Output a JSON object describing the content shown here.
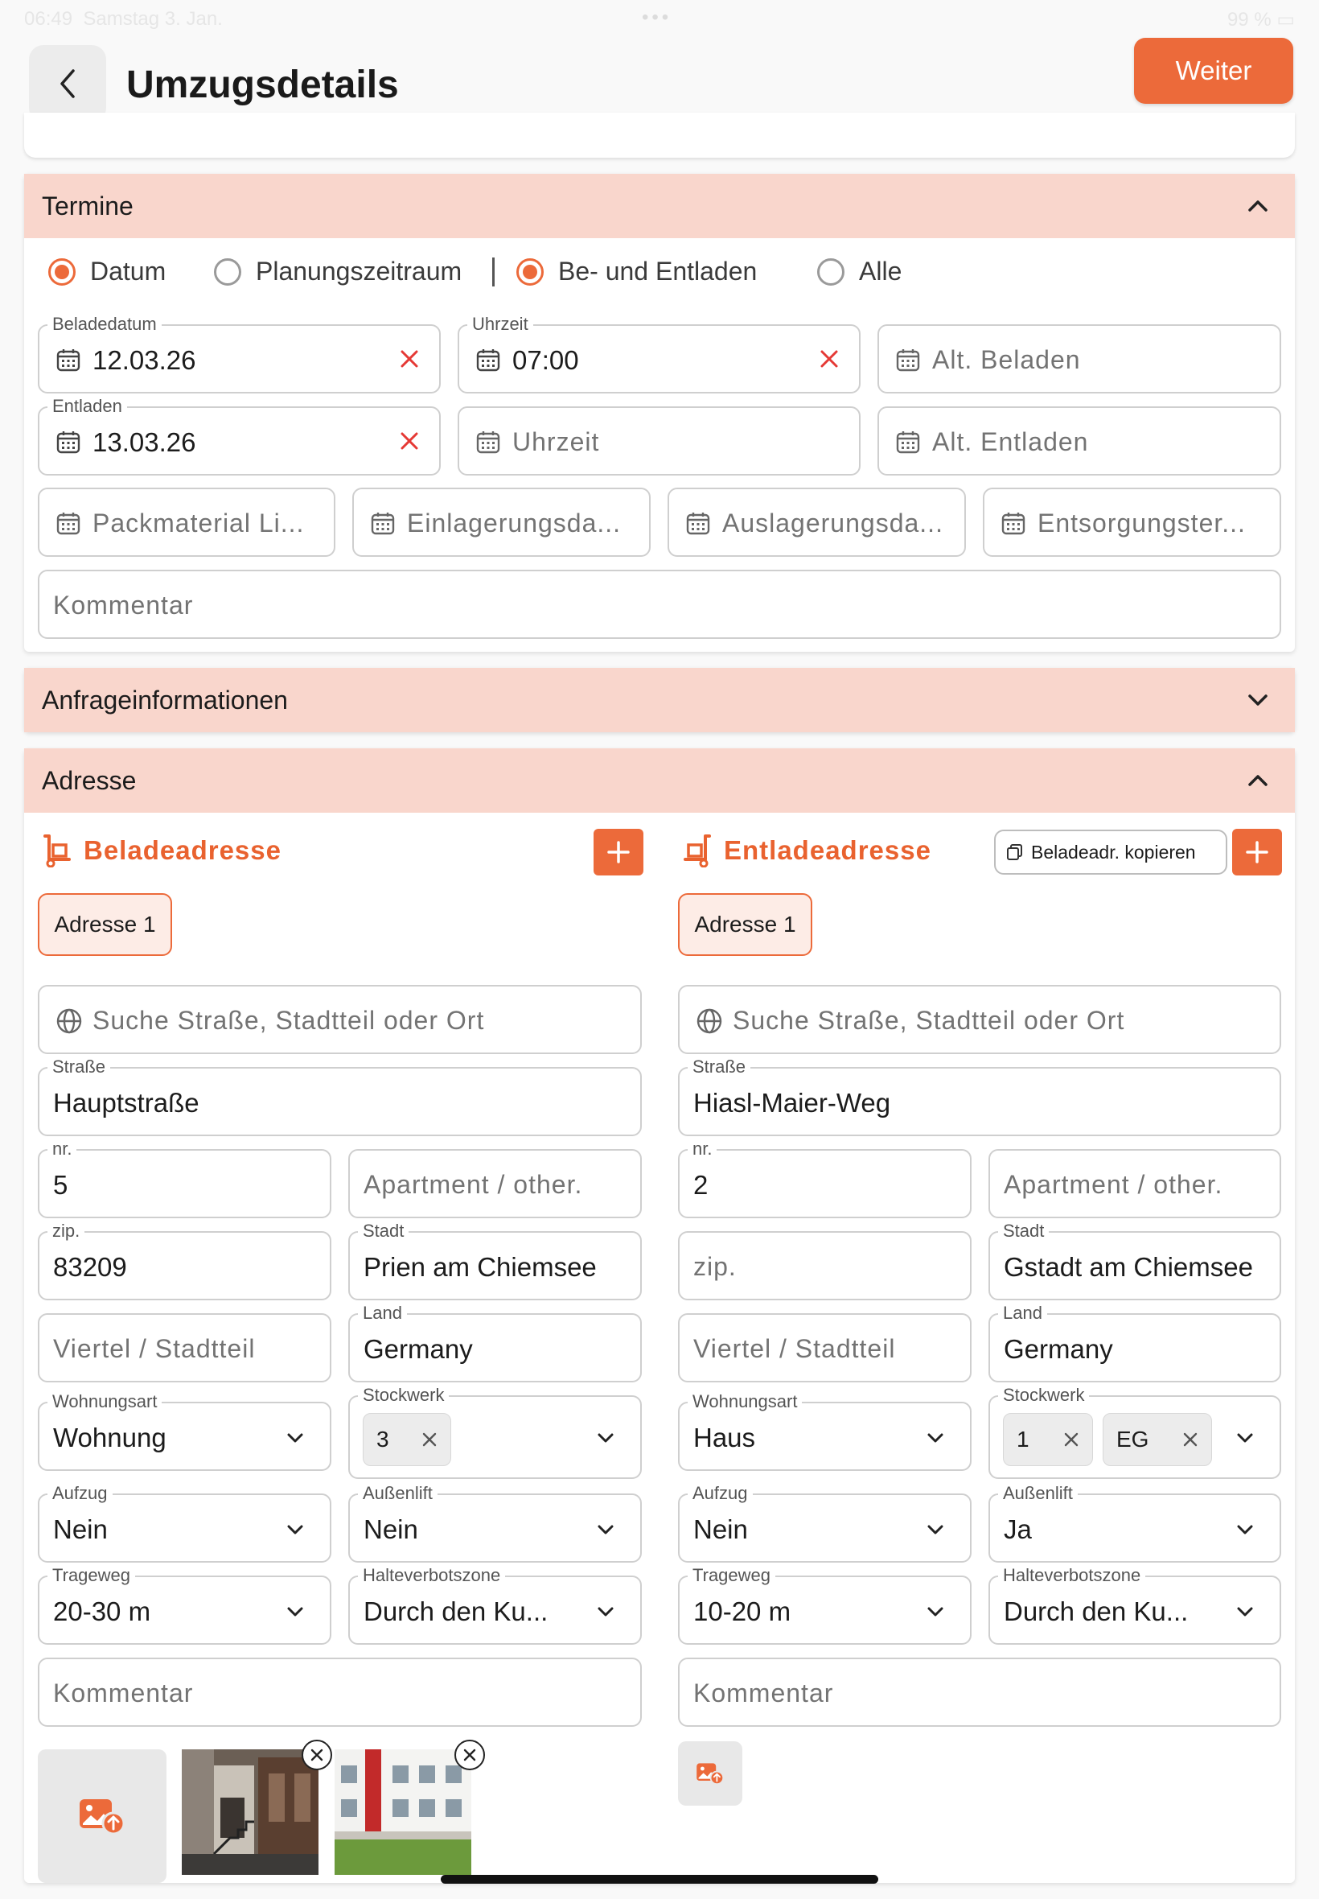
{
  "status": {
    "time": "06:49",
    "date": "Samstag 3. Jan.",
    "battery": "99 %"
  },
  "header": {
    "title": "Umzugsdetails",
    "next_label": "Weiter"
  },
  "termine": {
    "title": "Termine",
    "radios": {
      "datum": "Datum",
      "planung": "Planungszeitraum",
      "beentladen": "Be- und Entladen",
      "alle": "Alle"
    },
    "beladedatum": {
      "label": "Beladedatum",
      "value": "12.03.26"
    },
    "uhrzeit_belade": {
      "label": "Uhrzeit",
      "value": "07:00"
    },
    "alt_beladen": {
      "placeholder": "Alt. Beladen"
    },
    "entladen": {
      "label": "Entladen",
      "value": "13.03.26"
    },
    "uhrzeit_entlade": {
      "placeholder": "Uhrzeit"
    },
    "alt_entladen": {
      "placeholder": "Alt. Entladen"
    },
    "packmaterial": {
      "placeholder": "Packmaterial Li..."
    },
    "einlagerung": {
      "placeholder": "Einlagerungsda..."
    },
    "auslagerung": {
      "placeholder": "Auslagerungsda..."
    },
    "entsorgung": {
      "placeholder": "Entsorgungster..."
    },
    "kommentar": {
      "placeholder": "Kommentar"
    }
  },
  "anfrage": {
    "title": "Anfrageinformationen"
  },
  "adresse": {
    "title": "Adresse",
    "belade": {
      "title": "Beladeadresse",
      "tab": "Adresse 1",
      "search_placeholder": "Suche Straße, Stadtteil oder Ort",
      "strasse": {
        "label": "Straße",
        "value": "Hauptstraße"
      },
      "nr": {
        "label": "nr.",
        "value": "5"
      },
      "apartment": {
        "placeholder": "Apartment / other."
      },
      "zip": {
        "label": "zip.",
        "value": "83209"
      },
      "stadt": {
        "label": "Stadt",
        "value": "Prien am Chiemsee"
      },
      "viertel": {
        "placeholder": "Viertel / Stadtteil"
      },
      "land": {
        "label": "Land",
        "value": "Germany"
      },
      "wohnungsart": {
        "label": "Wohnungsart",
        "value": "Wohnung"
      },
      "stockwerk": {
        "label": "Stockwerk",
        "chips": [
          "3"
        ]
      },
      "aufzug": {
        "label": "Aufzug",
        "value": "Nein"
      },
      "aussenlift": {
        "label": "Außenlift",
        "value": "Nein"
      },
      "trageweg": {
        "label": "Trageweg",
        "value": "20-30 m"
      },
      "halteverbot": {
        "label": "Halteverbotszone",
        "value": "Durch den Ku..."
      },
      "kommentar": {
        "placeholder": "Kommentar"
      }
    },
    "entlade": {
      "title": "Entladeadresse",
      "copy_label": "Beladeadr. kopieren",
      "tab": "Adresse 1",
      "search_placeholder": "Suche Straße, Stadtteil oder Ort",
      "strasse": {
        "label": "Straße",
        "value": "Hiasl-Maier-Weg"
      },
      "nr": {
        "label": "nr.",
        "value": "2"
      },
      "apartment": {
        "placeholder": "Apartment / other."
      },
      "zip": {
        "placeholder": "zip."
      },
      "stadt": {
        "label": "Stadt",
        "value": "Gstadt am Chiemsee"
      },
      "viertel": {
        "placeholder": "Viertel / Stadtteil"
      },
      "land": {
        "label": "Land",
        "value": "Germany"
      },
      "wohnungsart": {
        "label": "Wohnungsart",
        "value": "Haus"
      },
      "stockwerk": {
        "label": "Stockwerk",
        "chips": [
          "1",
          "EG"
        ]
      },
      "aufzug": {
        "label": "Aufzug",
        "value": "Nein"
      },
      "aussenlift": {
        "label": "Außenlift",
        "value": "Ja"
      },
      "trageweg": {
        "label": "Trageweg",
        "value": "10-20 m"
      },
      "halteverbot": {
        "label": "Halteverbotszone",
        "value": "Durch den Ku..."
      },
      "kommentar": {
        "placeholder": "Kommentar"
      }
    }
  },
  "colors": {
    "accent": "#ec6a3a",
    "section_header": "#f9d6cc",
    "clear_icon": "#e53935"
  }
}
